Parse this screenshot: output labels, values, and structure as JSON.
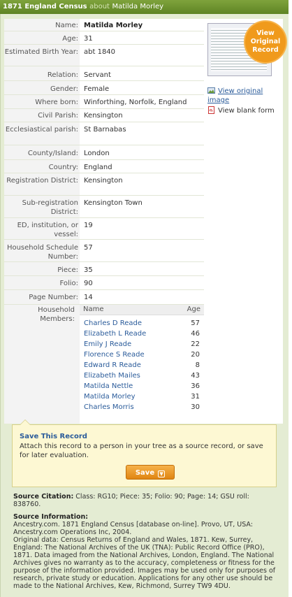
{
  "header": {
    "collection": "1871 England Census",
    "about": "about",
    "person": "Matilda Morley"
  },
  "record": [
    {
      "label": "Name:",
      "value": "Matilda Morley",
      "bold": true
    },
    {
      "label": "Age:",
      "value": "31"
    },
    {
      "label": "Estimated Birth Year:",
      "value": "abt 1840"
    },
    {
      "label": "Relation:",
      "value": "Servant"
    },
    {
      "label": "Gender:",
      "value": "Female"
    },
    {
      "label": "Where born:",
      "value": "Winforthing, Norfolk, England"
    },
    {
      "label": "Civil Parish:",
      "value": "Kensington"
    },
    {
      "label": "Ecclesiastical parish:",
      "value": "St Barnabas"
    },
    {
      "label": "County/Island:",
      "value": "London"
    },
    {
      "label": "Country:",
      "value": "England"
    },
    {
      "label": "Registration District:",
      "value": "Kensington"
    },
    {
      "label": "Sub-registration District:",
      "value": "Kensington Town"
    },
    {
      "label": "ED, institution, or vessel:",
      "value": "19"
    },
    {
      "label": "Household Schedule Number:",
      "value": "57"
    },
    {
      "label": "Piece:",
      "value": "35"
    },
    {
      "label": "Folio:",
      "value": "90"
    },
    {
      "label": "Page Number:",
      "value": "14"
    }
  ],
  "household": {
    "label": "Household Members:",
    "col_name": "Name",
    "col_age": "Age",
    "members": [
      {
        "name": "Charles D Reade",
        "age": "57"
      },
      {
        "name": "Elizabeth L Reade",
        "age": "46"
      },
      {
        "name": "Emily J Reade",
        "age": "22"
      },
      {
        "name": "Florence S Reade",
        "age": "20"
      },
      {
        "name": "Edward R Reade",
        "age": "8"
      },
      {
        "name": "Elizabeth Mailes",
        "age": "43"
      },
      {
        "name": "Matilda Nettle",
        "age": "36"
      },
      {
        "name": "Matilda Morley",
        "age": "31"
      },
      {
        "name": "Charles Morris",
        "age": "30"
      }
    ]
  },
  "sidebar": {
    "badge_line1": "View",
    "badge_line2": "Original",
    "badge_line3": "Record",
    "view_original": "View original image",
    "view_blank": "View blank form"
  },
  "save": {
    "title": "Save This Record",
    "desc": "Attach this record to a person in your tree as a source record, or save for later evaluation.",
    "button": "Save"
  },
  "citation": {
    "heading": "Source Citation:",
    "text": "Class: RG10; Piece: 35; Folio: 90; Page: 14; GSU roll: 838760."
  },
  "source_info": {
    "heading": "Source Information:",
    "line1": "Ancestry.com. 1871 England Census [database on-line]. Provo, UT, USA: Ancestry.com Operations Inc, 2004.",
    "line2": "Original data: Census Returns of England and Wales, 1871. Kew, Surrey, England: The National Archives of the UK (TNA): Public Record Office (PRO), 1871. Data imaged from the National Archives, London, England. The National Archives gives no warranty as to the accuracy, completeness or fitness for the purpose of the information provided. Images may be used only for purposes of research, private study or education. Applications for any other use should be made to the National Archives, Kew, Richmond, Surrey TW9 4DU."
  },
  "colors": {
    "header": "#6b8f2e",
    "link": "#2a5b9a",
    "save_button": "#f0941a",
    "badge": "#f09a1c"
  }
}
